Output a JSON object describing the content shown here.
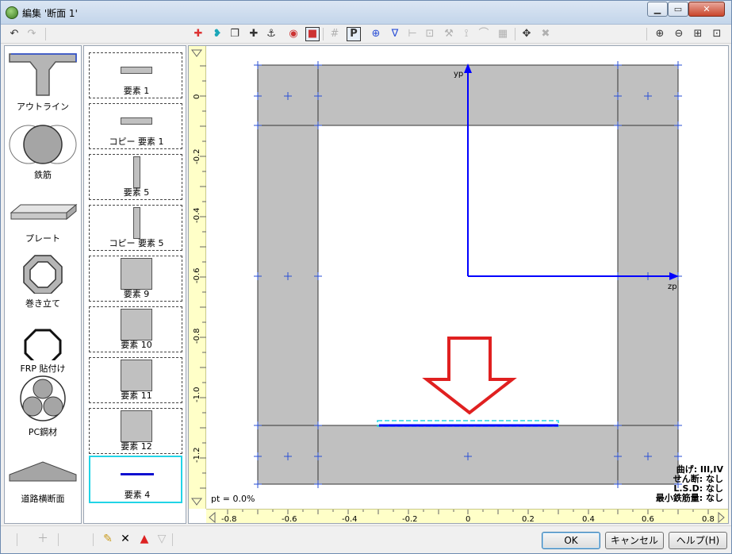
{
  "window": {
    "title": "編集 '断面 1'",
    "min_glyph": "▁",
    "max_glyph": "▭",
    "close_glyph": "✕"
  },
  "palette": [
    {
      "label": "アウトライン",
      "icon": "outline-icon"
    },
    {
      "label": "鉄筋",
      "icon": "rebar-icon"
    },
    {
      "label": "プレート",
      "icon": "plate-icon"
    },
    {
      "label": "巻き立て",
      "icon": "jacketing-icon"
    },
    {
      "label": "FRP 貼付け",
      "icon": "frp-icon"
    },
    {
      "label": "PC鋼材",
      "icon": "pc-steel-icon"
    },
    {
      "label": "道路横断面",
      "icon": "road-section-icon"
    }
  ],
  "elements": [
    {
      "label": "要素  1",
      "shape": "hbar"
    },
    {
      "label": "コピー 要素  1",
      "shape": "hbar"
    },
    {
      "label": "要素  5",
      "shape": "vbar"
    },
    {
      "label": "コピー 要素  5",
      "shape": "vbar"
    },
    {
      "label": "要素  9",
      "shape": "square"
    },
    {
      "label": "要素  10",
      "shape": "square"
    },
    {
      "label": "要素  11",
      "shape": "square"
    },
    {
      "label": "要素  12",
      "shape": "square"
    },
    {
      "label": "要素  4",
      "shape": "line",
      "selected": true
    }
  ],
  "canvas": {
    "axis_y_label": "yp",
    "axis_z_label": "zp",
    "x_ticks": [
      "-0.8",
      "-0.6",
      "-0.4",
      "-0.2",
      "0",
      "0.2",
      "0.4",
      "0.6",
      "0.8"
    ],
    "y_ticks": [
      "0",
      "-0.2",
      "-0.4",
      "-0.6",
      "-0.8",
      "-1.0",
      "-1.2"
    ],
    "pt_label": "pt = 0.0%",
    "info": {
      "bending": "曲げ: III,IV",
      "shear": "せん断: なし",
      "lsd": "L.S.D: なし",
      "min_rebar": "最小鉄筋量: なし"
    },
    "colors": {
      "section_fill": "#c0c0c0",
      "axis": "#0000ff",
      "arrow": "#e02020",
      "highlight": "#22d4e6"
    }
  },
  "buttons": {
    "ok": "OK",
    "cancel": "キャンセル",
    "help": "ヘルプ(H)"
  }
}
